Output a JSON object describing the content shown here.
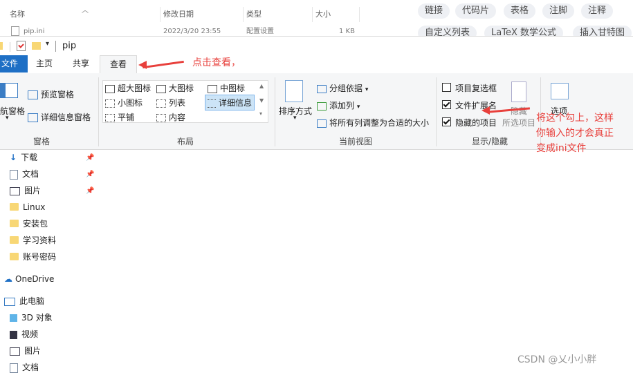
{
  "background_window": {
    "columns": [
      "名称",
      "修改日期",
      "类型",
      "大小"
    ],
    "row": {
      "name": "pip.ini",
      "date": "2022/3/20 23:55",
      "type": "配置设置",
      "size": "1 KB"
    }
  },
  "csdn": {
    "tags": [
      "链接",
      "代码片",
      "表格",
      "注脚",
      "注释",
      "自定义列表",
      "LaTeX 数学公式",
      "插入甘特图"
    ],
    "watermark": "CSDN @乂小小胖"
  },
  "explorer": {
    "path": "pip",
    "tabs": [
      "文件",
      "主页",
      "共享",
      "查看"
    ],
    "ribbon": {
      "panes": {
        "nav_pane": "航窗格",
        "preview": "预览窗格",
        "details_pane": "详细信息窗格",
        "label": "窗格"
      },
      "layout": {
        "items": [
          "超大图标",
          "大图标",
          "中图标",
          "小图标",
          "列表",
          "详细信息",
          "平铺",
          "内容"
        ],
        "label": "布局"
      },
      "current_view": {
        "sort": "排序方式",
        "group": "分组依据",
        "add_col": "添加列",
        "fit": "将所有列调整为合适的大小",
        "label": "当前视图"
      },
      "show_hide": {
        "item_checkbox": "项目复选框",
        "item_checkbox_checked": false,
        "file_ext": "文件扩展名",
        "file_ext_checked": true,
        "hidden_items": "隐藏的项目",
        "hidden_items_checked": true,
        "hide": "隐藏",
        "hide_selected": "所选项目",
        "label": "显示/隐藏"
      },
      "options": "选项"
    },
    "nav": [
      {
        "label": "下载",
        "pinned": true
      },
      {
        "label": "文档",
        "pinned": true
      },
      {
        "label": "图片",
        "pinned": true
      },
      {
        "label": "Linux"
      },
      {
        "label": "安装包"
      },
      {
        "label": "学习资料"
      },
      {
        "label": "账号密码"
      },
      {
        "label": "OneDrive"
      },
      {
        "label": "此电脑"
      },
      {
        "label": "3D 对象"
      },
      {
        "label": "视频"
      },
      {
        "label": "图片"
      },
      {
        "label": "文档"
      }
    ]
  },
  "annotations": {
    "click_view": "点击查看，",
    "check_note_1": "将这个勾上，这样",
    "check_note_2": "你输入的才会真正",
    "check_note_3": "变成ini文件"
  },
  "colors": {
    "accent": "#1e6fc5",
    "annotation": "#e8403c",
    "ribbon": "#f5f6f7"
  }
}
